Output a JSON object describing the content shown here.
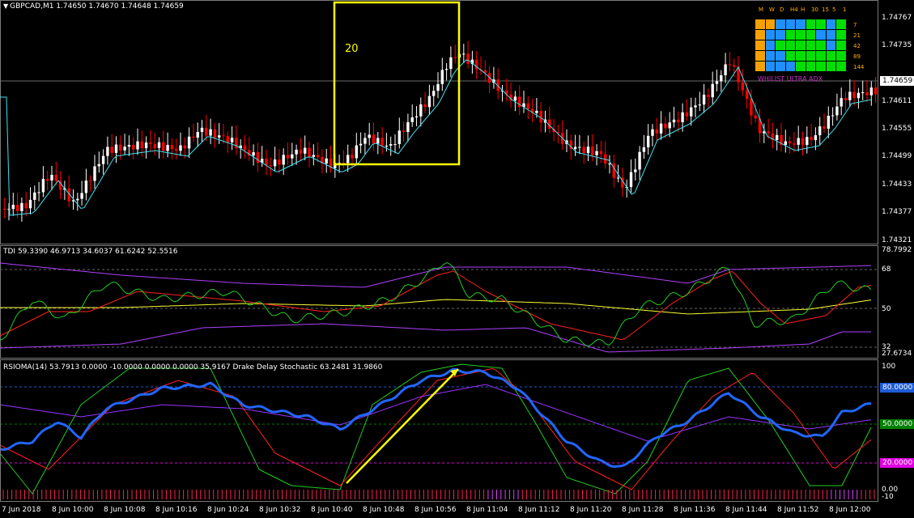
{
  "main_chart": {
    "title": "GBPCAD,M1  1.74650 1.74670 1.74648 1.74659",
    "price_axis": [
      "1.74767",
      "1.74735",
      "1.74659",
      "1.74611",
      "1.74555",
      "1.74499",
      "1.74433",
      "1.74377",
      "1.74321"
    ],
    "current_price_tag": "1.74659",
    "box_label": "20",
    "mtf_indicator": {
      "headers": [
        "M",
        "W",
        "D",
        "H4",
        "H",
        "30",
        "15",
        "5",
        "1"
      ],
      "periods": [
        "7",
        "21",
        "42",
        "89",
        "144"
      ],
      "name": "WHILIST ULTRA ADX",
      "grid_colors": [
        [
          "#f7a100",
          "#f7a100",
          "#1e90ff",
          "#1e90ff",
          "#1e90ff",
          "#00e000",
          "#00e000",
          "#1e90ff",
          "#00e000"
        ],
        [
          "#f7a100",
          "#1e90ff",
          "#1e90ff",
          "#00e000",
          "#00e000",
          "#00e000",
          "#1e90ff",
          "#1e90ff",
          "#00e000"
        ],
        [
          "#f7a100",
          "#1e90ff",
          "#00e000",
          "#00e000",
          "#00e000",
          "#00e000",
          "#00e000",
          "#1e90ff",
          "#00e000"
        ],
        [
          "#f7a100",
          "#1e90ff",
          "#1e90ff",
          "#00e000",
          "#00e000",
          "#00e000",
          "#00e000",
          "#00e000",
          "#00e000"
        ],
        [
          "#f7a100",
          "#1e90ff",
          "#1e90ff",
          "#1e90ff",
          "#00e000",
          "#00e000",
          "#00e000",
          "#00e000",
          "#00e000"
        ]
      ]
    }
  },
  "tdi_panel": {
    "title": "TDI 59.3390 46.9713 34.6037 61.6242 52.5516",
    "axis": [
      "78.7992",
      "68",
      "50",
      "32",
      "27.6734"
    ]
  },
  "rsioma_panel": {
    "title": "RSIOMA(14) 53.7913 0.0000 -10.0000 0.0000 0.0000 35.9167  Drake Delay Stochastic 63.2481 31.9860",
    "axis": [
      "100",
      "0.00",
      "-10"
    ],
    "levels": [
      {
        "label": "80.0000",
        "color": "#1e5bd6"
      },
      {
        "label": "50.0000",
        "color": "#008000"
      },
      {
        "label": "20.0000",
        "color": "#e000e0"
      }
    ]
  },
  "time_axis": [
    "7 Jun 2018",
    "8 Jun 10:00",
    "8 Jun 10:08",
    "8 Jun 10:16",
    "8 Jun 10:24",
    "8 Jun 10:32",
    "8 Jun 10:40",
    "8 Jun 10:48",
    "8 Jun 10:56",
    "8 Jun 11:04",
    "8 Jun 11:12",
    "8 Jun 11:20",
    "8 Jun 11:28",
    "8 Jun 11:36",
    "8 Jun 11:44",
    "8 Jun 11:52",
    "8 Jun 12:00"
  ],
  "colors": {
    "bull": "#ffffff",
    "bear": "#ff0000",
    "ma": "#40e0f0",
    "highlight": "#ffff00"
  }
}
